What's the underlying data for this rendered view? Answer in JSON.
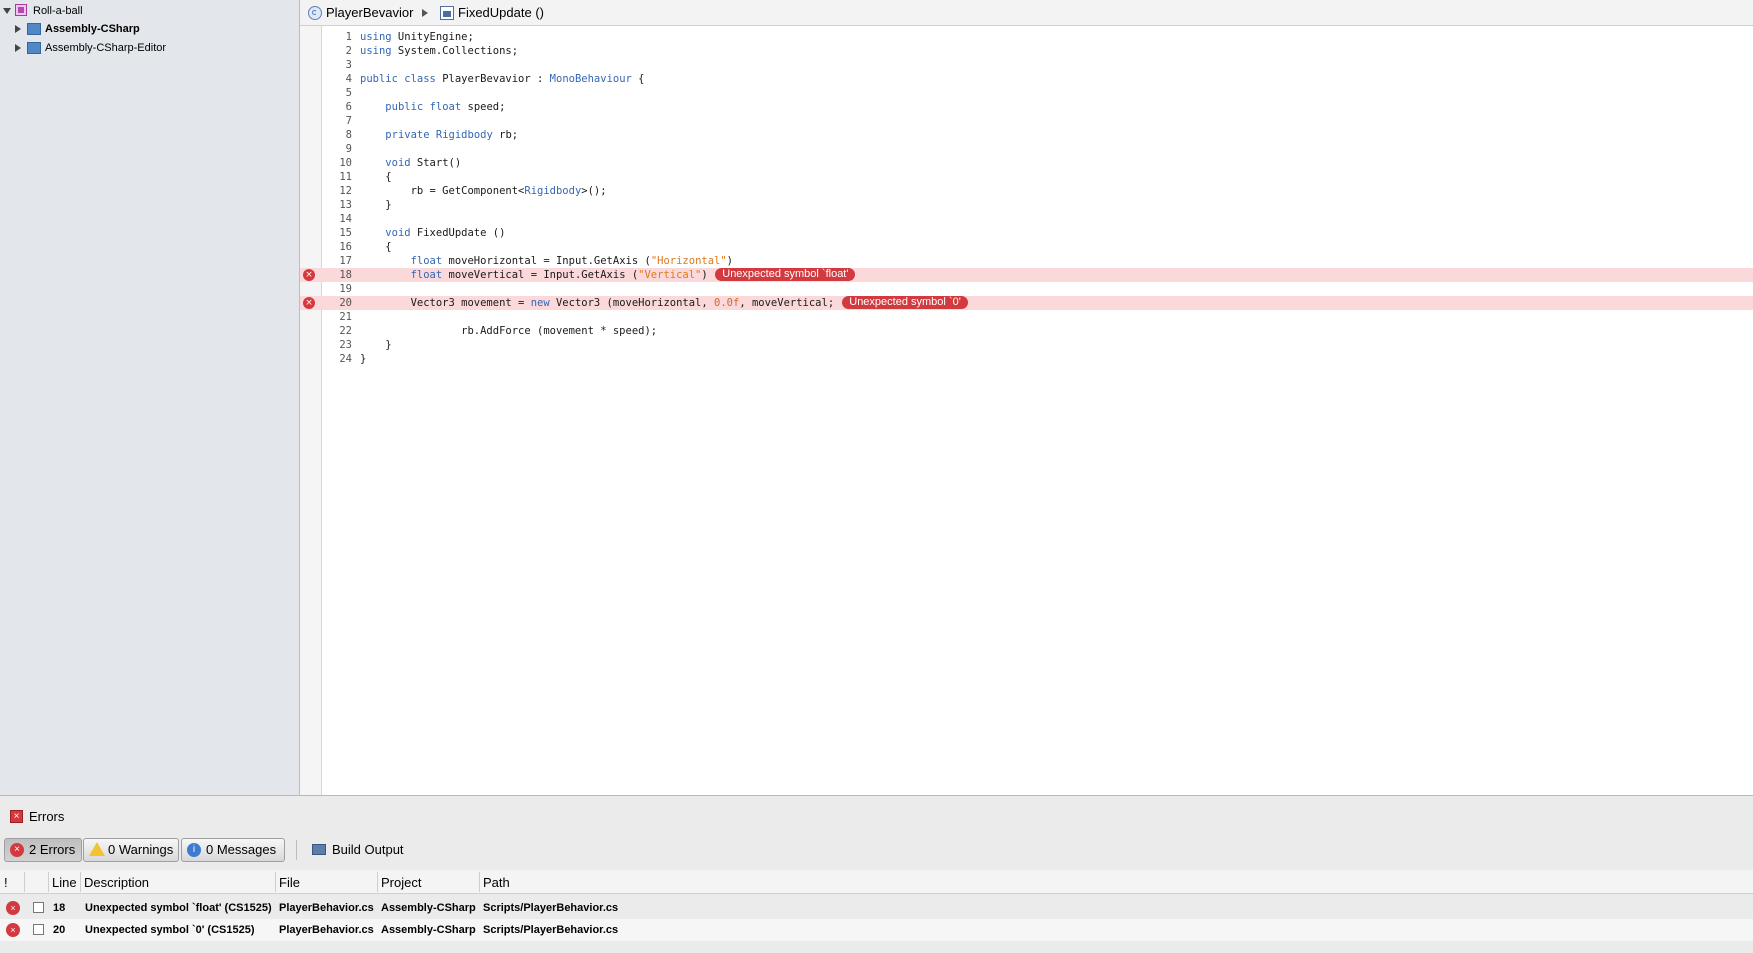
{
  "solution": {
    "root": {
      "label": "Roll-a-ball",
      "expanded": true
    },
    "projects": [
      {
        "label": "Assembly-CSharp",
        "bold": true
      },
      {
        "label": "Assembly-CSharp-Editor",
        "bold": false
      }
    ]
  },
  "breadcrumb": {
    "class_name": "PlayerBevavior",
    "method_name": "FixedUpdate ()"
  },
  "code_lines": [
    {
      "n": "1",
      "text": "using UnityEngine;"
    },
    {
      "n": "2",
      "text": "using System.Collections;"
    },
    {
      "n": "3",
      "text": ""
    },
    {
      "n": "4",
      "text": "public class PlayerBevavior : MonoBehaviour {"
    },
    {
      "n": "5",
      "text": ""
    },
    {
      "n": "6",
      "text": "    public float speed;"
    },
    {
      "n": "7",
      "text": ""
    },
    {
      "n": "8",
      "text": "    private Rigidbody rb;"
    },
    {
      "n": "9",
      "text": ""
    },
    {
      "n": "10",
      "text": "    void Start()"
    },
    {
      "n": "11",
      "text": "    {"
    },
    {
      "n": "12",
      "text": "        rb = GetComponent<Rigidbody>();"
    },
    {
      "n": "13",
      "text": "    }"
    },
    {
      "n": "14",
      "text": ""
    },
    {
      "n": "15",
      "text": "    void FixedUpdate ()"
    },
    {
      "n": "16",
      "text": "    {"
    },
    {
      "n": "17",
      "text": "        float moveHorizontal = Input.GetAxis (\"Horizontal\")"
    },
    {
      "n": "18",
      "text": "        float moveVertical = Input.GetAxis (\"Vertical\")",
      "error": "Unexpected symbol `float'"
    },
    {
      "n": "19",
      "text": ""
    },
    {
      "n": "20",
      "text": "        Vector3 movement = new Vector3 (moveHorizontal, 0.0f, moveVertical;",
      "error": "Unexpected symbol `0'"
    },
    {
      "n": "21",
      "text": ""
    },
    {
      "n": "22",
      "text": "                rb.AddForce (movement * speed);"
    },
    {
      "n": "23",
      "text": "    }"
    },
    {
      "n": "24",
      "text": "}"
    }
  ],
  "error_pad": {
    "title": "Errors",
    "filters": {
      "errors": "2 Errors",
      "warnings": "0 Warnings",
      "messages": "0 Messages"
    },
    "build_output": "Build Output",
    "columns": {
      "icon": "!",
      "line": "Line",
      "description": "Description",
      "file": "File",
      "project": "Project",
      "path": "Path"
    },
    "rows": [
      {
        "line": "18",
        "description": "Unexpected symbol `float' (CS1525)",
        "file": "PlayerBehavior.cs",
        "project": "Assembly-CSharp",
        "path": "Scripts/PlayerBehavior.cs"
      },
      {
        "line": "20",
        "description": "Unexpected symbol `0' (CS1525)",
        "file": "PlayerBehavior.cs",
        "project": "Assembly-CSharp",
        "path": "Scripts/PlayerBehavior.cs"
      }
    ]
  },
  "colors": {
    "error_red": "#d23a3f",
    "error_line_bg": "#fbd8da",
    "keyword_blue": "#3567b3",
    "string_orange": "#dc7a1f",
    "sidebar_bg": "#e3e6eb"
  },
  "icons": {
    "solution": "solution-icon",
    "project": "csharp-project-icon",
    "class": "class-icon",
    "method": "method-icon",
    "error": "error-icon",
    "warning": "warning-icon",
    "info": "info-icon",
    "build": "build-output-icon"
  }
}
